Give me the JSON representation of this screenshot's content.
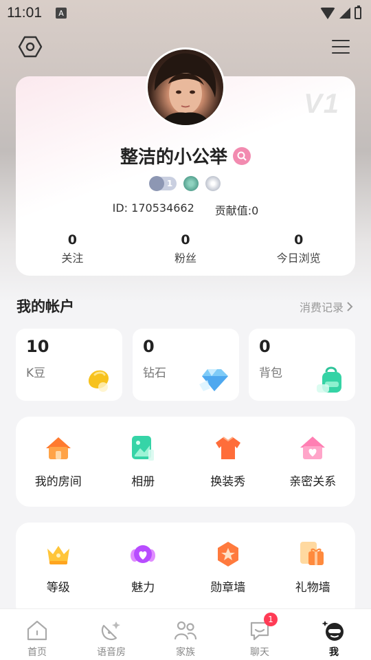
{
  "status_bar": {
    "time": "11:01",
    "notification_glyph": "A"
  },
  "profile": {
    "vip_label": "V1",
    "nickname": "整洁的小公举",
    "level_badge_value": "1",
    "id_text": "ID: 170534662",
    "contribution_text": "贡献值:0",
    "stats": [
      {
        "value": "0",
        "label": "关注"
      },
      {
        "value": "0",
        "label": "粉丝"
      },
      {
        "value": "0",
        "label": "今日浏览"
      }
    ]
  },
  "account": {
    "title": "我的帐户",
    "records_link": "消费记录",
    "assets": [
      {
        "value": "10",
        "label": "K豆",
        "icon": "bean-icon"
      },
      {
        "value": "0",
        "label": "钻石",
        "icon": "diamond-icon"
      },
      {
        "value": "0",
        "label": "背包",
        "icon": "backpack-icon"
      }
    ]
  },
  "features_row1": [
    {
      "label": "我的房间",
      "icon": "house-icon"
    },
    {
      "label": "相册",
      "icon": "album-icon"
    },
    {
      "label": "换装秀",
      "icon": "shirt-icon"
    },
    {
      "label": "亲密关系",
      "icon": "heart-house-icon"
    }
  ],
  "features_row2": [
    {
      "label": "等级",
      "icon": "crown-icon"
    },
    {
      "label": "魅力",
      "icon": "charm-icon"
    },
    {
      "label": "勋章墙",
      "icon": "medal-icon"
    },
    {
      "label": "礼物墙",
      "icon": "gift-icon"
    }
  ],
  "tabbar": {
    "tabs": [
      {
        "label": "首页",
        "icon": "home-icon"
      },
      {
        "label": "语音房",
        "icon": "voice-room-icon"
      },
      {
        "label": "家族",
        "icon": "family-icon"
      },
      {
        "label": "聊天",
        "icon": "chat-icon"
      },
      {
        "label": "我",
        "icon": "me-icon"
      }
    ],
    "active_tab": "我",
    "chat_badge": "1"
  },
  "colors": {
    "accent_pink": "#f28bb0",
    "badge_red": "#ff3b55",
    "orange": "#ff8a3d"
  }
}
